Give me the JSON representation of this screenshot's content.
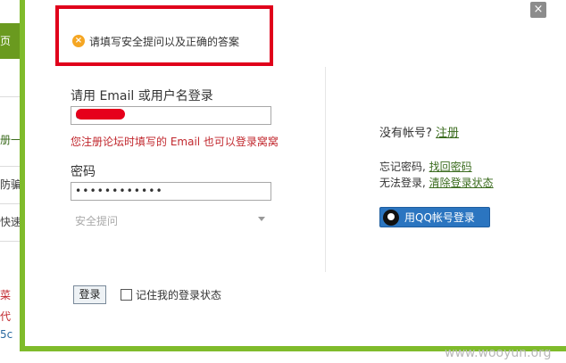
{
  "background": {
    "nav_fragment": "页",
    "fragments": [
      "册一",
      "防骗",
      "快速",
      "菜",
      "代",
      "5c"
    ]
  },
  "dialog": {
    "close_glyph": "×",
    "warning": "请填写安全提问以及正确的答案",
    "account_label": "请用 Email 或用户名登录",
    "account_value": "c          m",
    "account_hint": "您注册论坛时填写的 Email 也可以登录窝窝",
    "password_label": "密码",
    "password_value": "••••••••••••",
    "security_question": "安全提问",
    "no_account_text": "没有帐号? ",
    "register_link": "注册",
    "forgot_password_text": "忘记密码, ",
    "find_password_link": "找回密码",
    "cant_login_text": "无法登录, ",
    "clear_login_link": "清除登录状态",
    "qq_login_label": "用QQ帐号登录",
    "login_button": "登录",
    "remember_label": "记住我的登录状态"
  },
  "watermark": "www.wooyun.org",
  "colors": {
    "frame_green": "#7fbb2b",
    "highlight_red": "#e0001b",
    "hint_red": "#c1272d",
    "link_green": "#3a6b1d",
    "qq_blue": "#2b75c0"
  },
  "icons": {
    "warning": "warning-circle-icon",
    "close": "close-icon",
    "qq": "qq-penguin-icon",
    "dropdown": "chevron-down-icon"
  }
}
